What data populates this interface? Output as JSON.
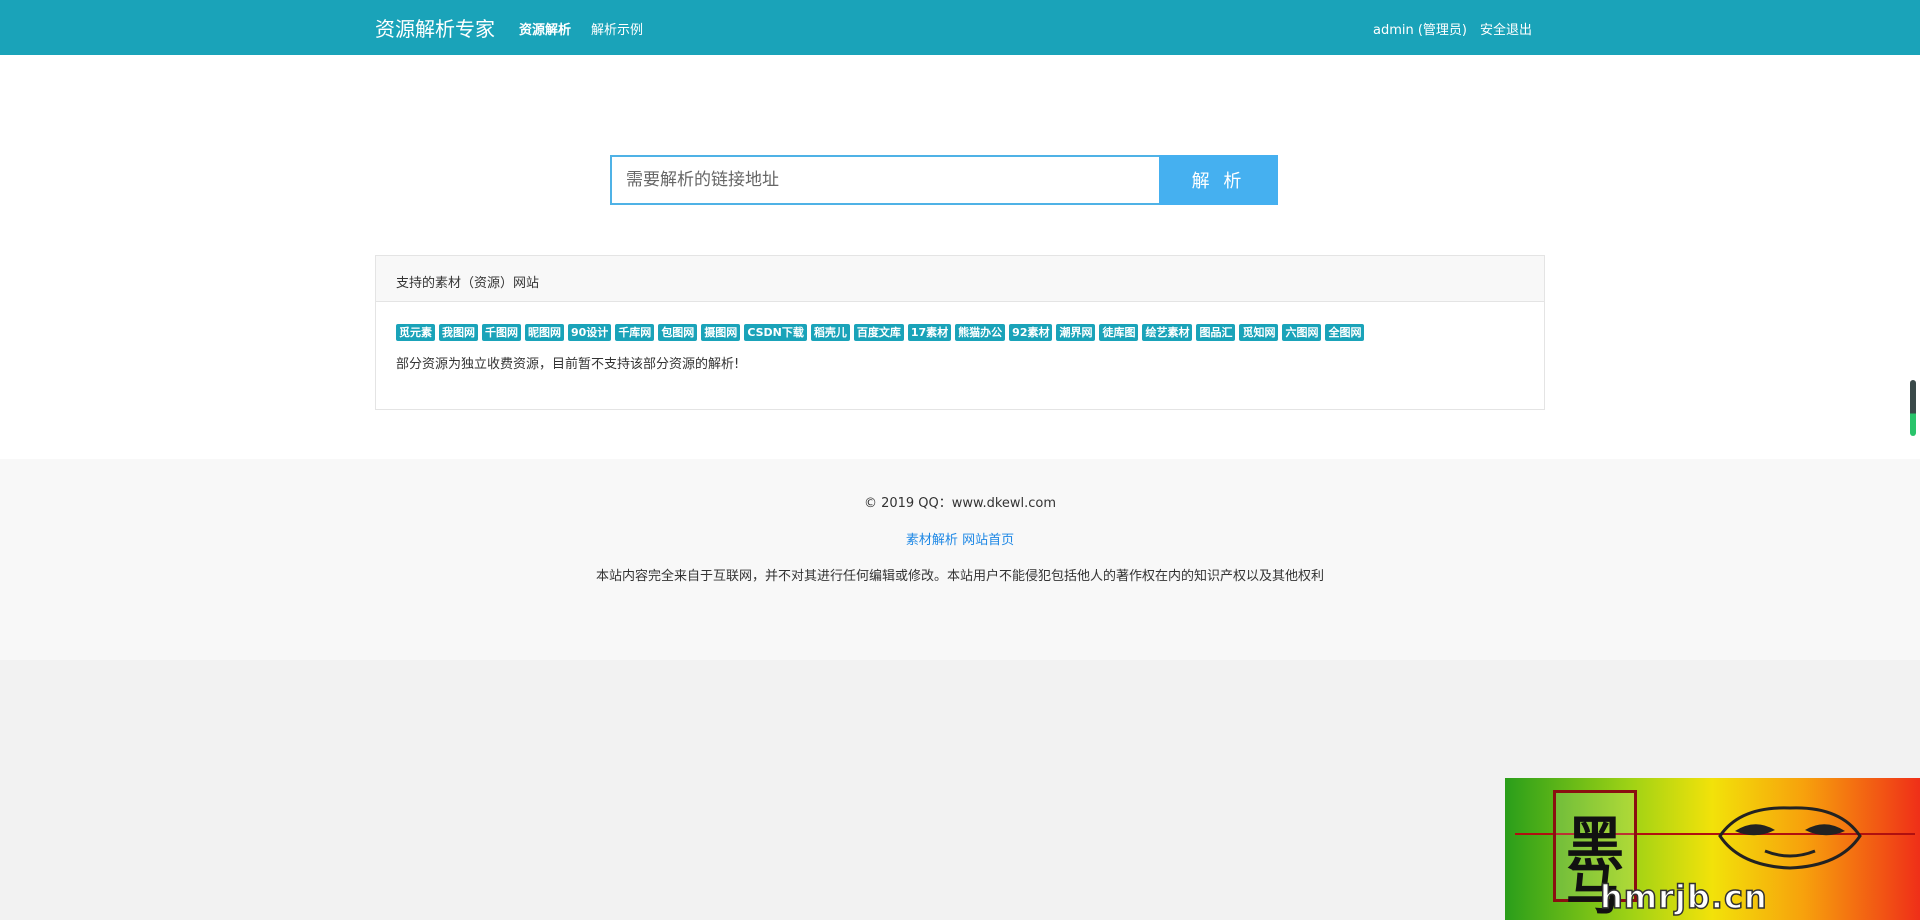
{
  "navbar": {
    "brand": "资源解析专家",
    "links": [
      "资源解析",
      "解析示例"
    ],
    "user": "admin (管理员)",
    "logout": "安全退出"
  },
  "search": {
    "placeholder": "需要解析的链接地址",
    "button": "解 析"
  },
  "panel": {
    "title": "支持的素材（资源）网站",
    "tags": [
      "觅元素",
      "我图网",
      "千图网",
      "昵图网",
      "90设计",
      "千库网",
      "包图网",
      "摄图网",
      "CSDN下载",
      "稻壳儿",
      "百度文库",
      "17素材",
      "熊猫办公",
      "92素材",
      "潮界网",
      "徒库图",
      "绘艺素材",
      "图品汇",
      "觅知网",
      "六图网",
      "全图网"
    ],
    "note": "部分资源为独立收费资源，目前暂不支持该部分资源的解析!"
  },
  "footer": {
    "copyright": "© 2019 QQ：www.dkewl.com",
    "link1": "素材解析",
    "link2": "网站首页",
    "disclaimer": "本站内容完全来自于互联网，并不对其进行任何编辑或修改。本站用户不能侵犯包括他人的著作权在内的知识产权以及其他权利"
  },
  "watermark": {
    "seal_char_1": "黑",
    "seal_char_2": "马",
    "site": "hmrjb.cn"
  },
  "colors": {
    "navbar": "#1aa3b9",
    "tag": "#1aa3b9",
    "search_button": "#45b0f0",
    "footer_link": "#1e88e5"
  }
}
